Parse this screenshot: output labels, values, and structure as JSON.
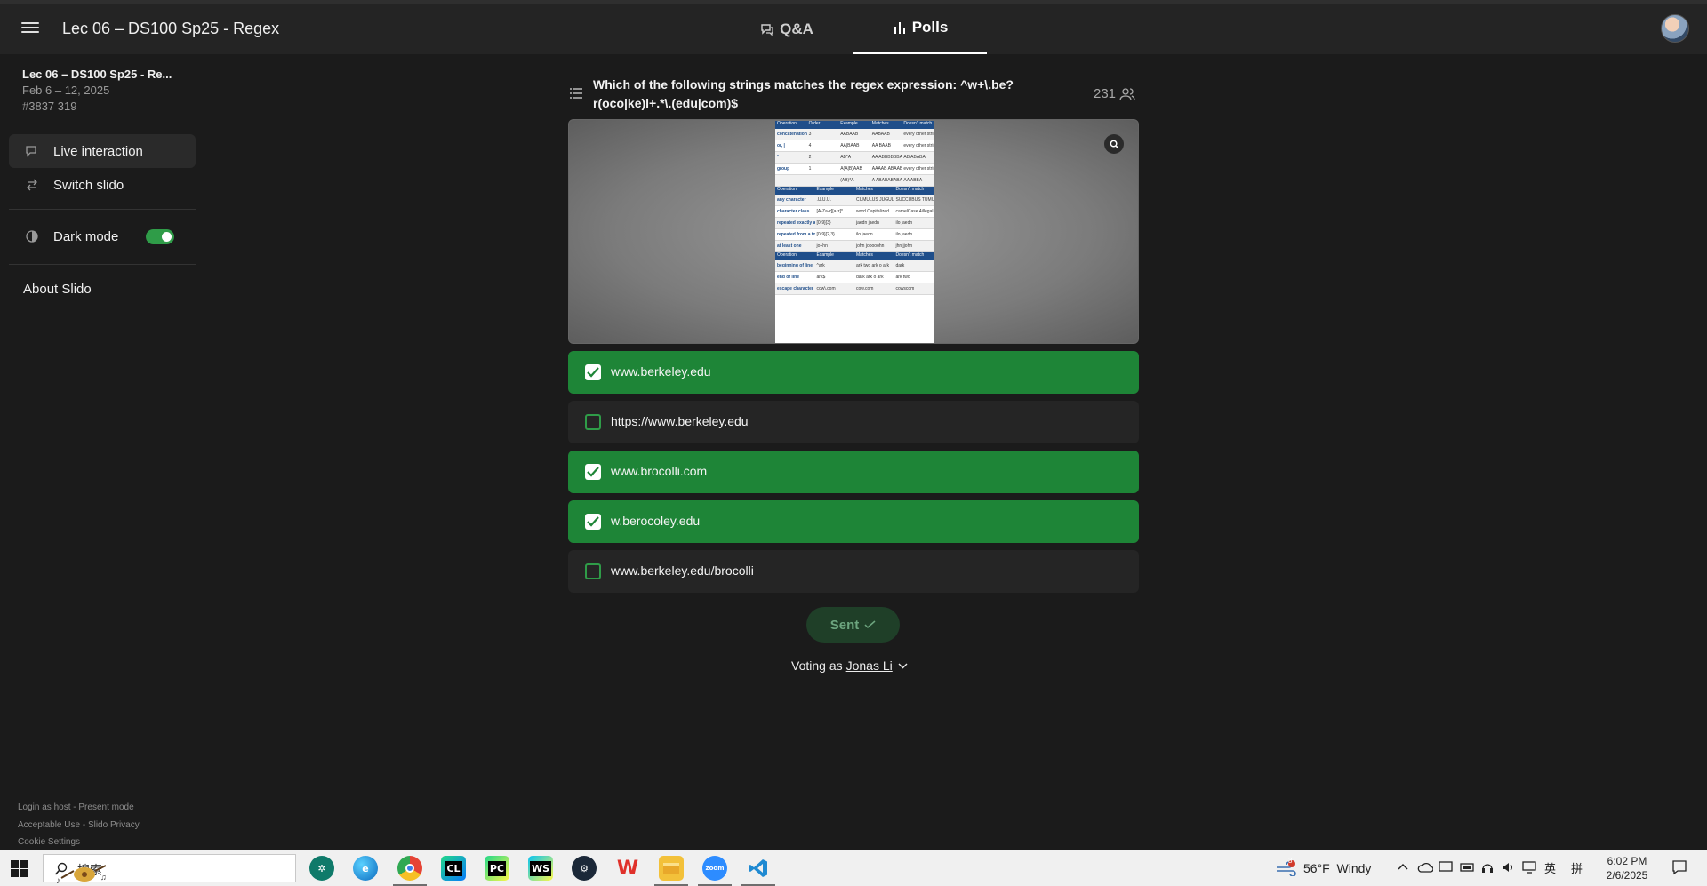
{
  "header": {
    "title": "Lec 06 – DS100 Sp25 - Regex",
    "tabs": [
      {
        "label": "Q&A",
        "icon": "chat-bubbles-icon",
        "active": false
      },
      {
        "label": "Polls",
        "icon": "bar-chart-icon",
        "active": true
      }
    ]
  },
  "sidebar": {
    "event_name": "Lec 06 – DS100 Sp25 - Re...",
    "event_dates": "Feb 6 – 12, 2025",
    "event_code": "#3837 319",
    "items": [
      {
        "label": "Live interaction",
        "icon": "chat-icon"
      },
      {
        "label": "Switch slido",
        "icon": "switch-icon"
      }
    ],
    "dark_mode_label": "Dark mode",
    "dark_mode_on": true,
    "about_label": "About Slido",
    "footer": {
      "login": "Login as host",
      "present": "Present mode",
      "acceptable_use": "Acceptable Use",
      "privacy": "Slido Privacy",
      "cookies": "Cookie Settings",
      "separator": " - "
    }
  },
  "poll": {
    "question_line1": "Which of the following strings matches the regex expression: ^w+\\.be?",
    "question_line2": "r(oco|ke)l+.*\\.(edu|com)$",
    "participants": "231",
    "image_table": {
      "headers1": [
        "Operation",
        "Order",
        "Example",
        "Matches",
        "Doesn't match"
      ],
      "rows1": [
        [
          "concatenation",
          "3",
          "AABAAB",
          "AABAAB",
          "every other string"
        ],
        [
          "or, |",
          "4",
          "AA|BAAB",
          "AA BAAB",
          "every other string"
        ],
        [
          "*",
          "2",
          "AB*A",
          "AA ABBBBBBA",
          "AB ABABA"
        ],
        [
          "group",
          "1",
          "A(A|B)AAB",
          "AAAAB ABAAB",
          "every other string"
        ],
        [
          "",
          "",
          "(AB)*A",
          "A ABABABABA",
          "AA ABBA"
        ]
      ],
      "headers2": [
        "Operation",
        "Example",
        "Matches",
        "Doesn't match"
      ],
      "rows2": [
        [
          "any character",
          ".U.U.U.",
          "CUMULUS JUGULUM",
          "SUCCUBUS TUMULTUOUS"
        ],
        [
          "character class",
          "[A-Za-z][a-z]*",
          "word Capitalized",
          "camelCase 4illegal"
        ],
        [
          "repeated exactly a times",
          "[0-9]{3}",
          "jaedn jaedn",
          "ilo jaedn"
        ],
        [
          "repeated from a to b times",
          "[0-9]{2,3}",
          "ilo jaedn",
          "ilo jaedn"
        ],
        [
          "at least one",
          "jo+hn",
          "john jooooohn",
          "jhn jjohn"
        ]
      ],
      "headers3": [
        "Operation",
        "Example",
        "Matches",
        "Doesn't match"
      ],
      "rows3": [
        [
          "beginning of line",
          "^ark",
          "ark two ark o ark",
          "dark"
        ],
        [
          "end of line",
          "ark$",
          "dark ark o ark",
          "ark two"
        ],
        [
          "escape character",
          "cow\\.com",
          "cow.com",
          "cowscom"
        ]
      ]
    },
    "options": [
      {
        "label": "www.berkeley.edu",
        "checked": true
      },
      {
        "label": "https://www.berkeley.edu",
        "checked": false
      },
      {
        "label": "www.brocolli.com",
        "checked": true
      },
      {
        "label": "w.berocoley.edu",
        "checked": true
      },
      {
        "label": "www.berkeley.edu/brocolli",
        "checked": false
      }
    ],
    "sent_label": "Sent",
    "voting_prefix": "Voting as",
    "voter_name": "Jonas Li"
  },
  "taskbar": {
    "search_placeholder": "搜索",
    "apps": [
      "chatgpt-icon",
      "edge-icon",
      "chrome-icon",
      "clion-icon",
      "pycharm-icon",
      "webstorm-icon",
      "steam-icon",
      "wps-icon",
      "file-explorer-icon",
      "zoom-icon",
      "vscode-icon"
    ],
    "app_labels": {
      "clion": "CL",
      "pycharm": "PC",
      "webstorm": "WS",
      "zoom": "zoom"
    },
    "weather_badge": "3",
    "weather": "56°F  Windy",
    "ime_lang": "英",
    "ime_mode": "拼",
    "time": "6:02 PM",
    "date": "2/6/2025"
  },
  "colors": {
    "accent_green": "#1e8537",
    "toggle_green": "#2f9c48",
    "background": "#1b1b1b",
    "header_bg": "#242424"
  }
}
